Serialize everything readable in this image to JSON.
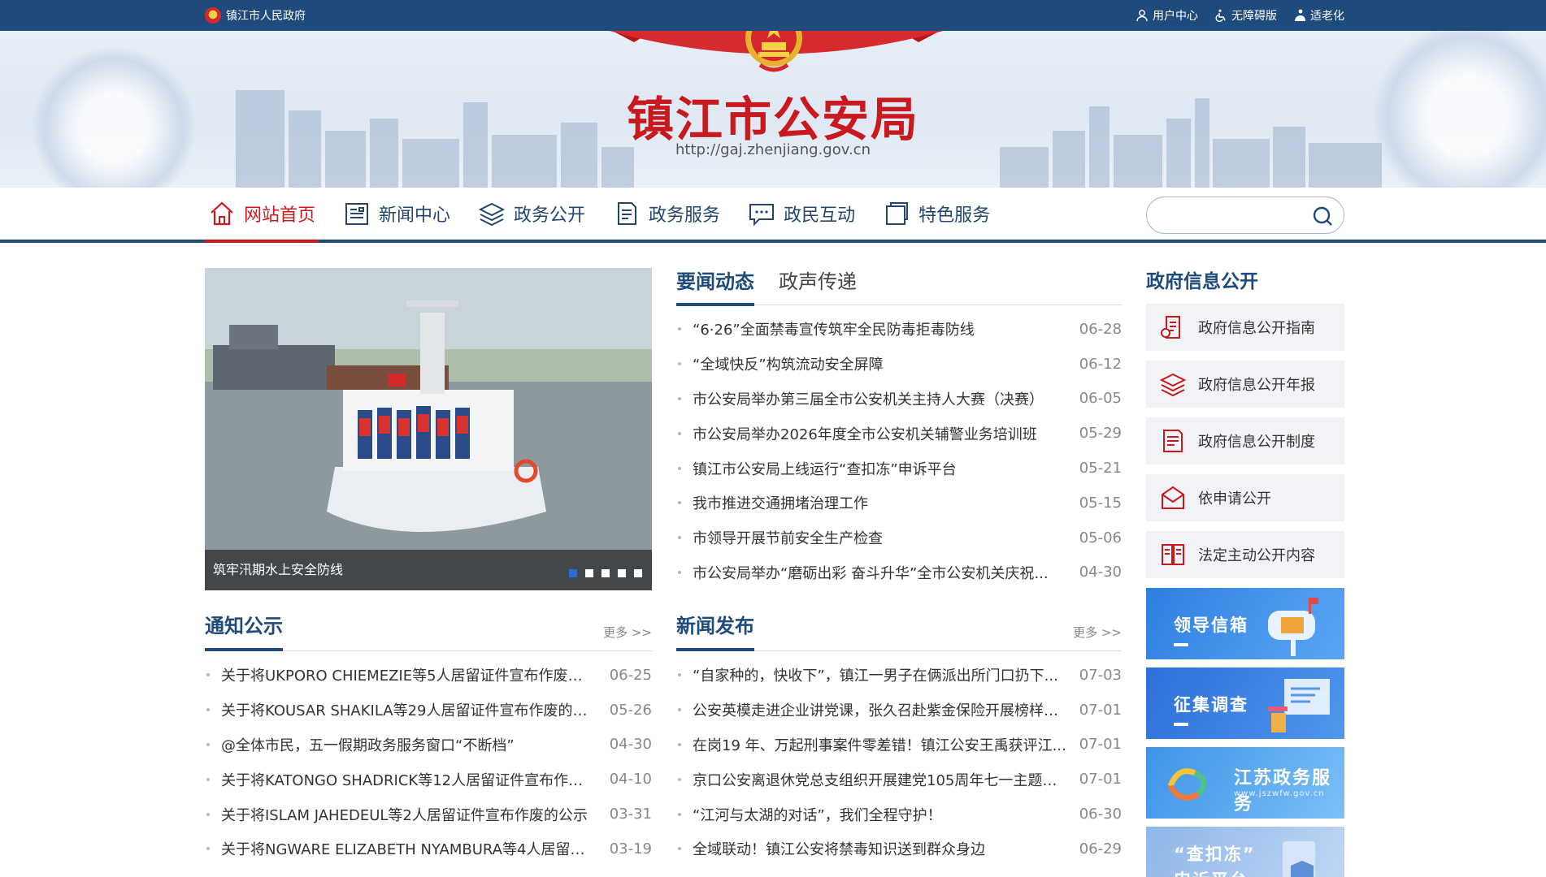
{
  "topbar": {
    "gov_link": "镇江市人民政府",
    "tools": [
      "用户中心",
      "无障碍版",
      "适老化"
    ]
  },
  "header": {
    "title": "镇江市公安局",
    "url": "http://gaj.zhenjiang.gov.cn"
  },
  "nav": {
    "items": [
      {
        "label": "网站首页",
        "icon": "home-icon",
        "active": true
      },
      {
        "label": "新闻中心",
        "icon": "newspaper-icon"
      },
      {
        "label": "政务公开",
        "icon": "layers-icon"
      },
      {
        "label": "政务服务",
        "icon": "document-icon"
      },
      {
        "label": "政民互动",
        "icon": "chat-icon"
      },
      {
        "label": "特色服务",
        "icon": "window-icon"
      }
    ],
    "search_placeholder": ""
  },
  "slider": {
    "caption": "筑牢汛期水上安全防线",
    "dots": 5,
    "active_dot": 1
  },
  "news_tabs": {
    "tabs": [
      "要闻动态",
      "政声传递"
    ],
    "active": 0,
    "items": [
      {
        "title": "“6·26”全面禁毒宣传筑牢全民防毒拒毒防线",
        "date": "06-28"
      },
      {
        "title": "“全域快反”构筑流动安全屏障",
        "date": "06-12"
      },
      {
        "title": "市公安局举办第三届全市公安机关主持人大赛（决赛）",
        "date": "06-05"
      },
      {
        "title": "市公安局举办2026年度全市公安机关辅警业务培训班",
        "date": "05-29"
      },
      {
        "title": "镇江市公安局上线运行“查扣冻”申诉平台",
        "date": "05-21"
      },
      {
        "title": "我市推进交通拥堵治理工作",
        "date": "05-15"
      },
      {
        "title": "市领导开展节前安全生产检查",
        "date": "05-06"
      },
      {
        "title": "市公安局举办“磨砺出彩 奋斗升华”全市公安机关庆祝...",
        "date": "04-30"
      }
    ]
  },
  "notices": {
    "title": "通知公示",
    "more": "更多 >>",
    "items": [
      {
        "title": "关于将UKPORO CHIEMEZIE等5人居留证件宣布作废的...",
        "date": "06-25"
      },
      {
        "title": "关于将KOUSAR SHAKILA等29人居留证件宣布作废的公示",
        "date": "05-26"
      },
      {
        "title": "@全体市民，五一假期政务服务窗口“不断档”",
        "date": "04-30"
      },
      {
        "title": "关于将KATONGO SHADRICK等12人居留证件宣布作废...",
        "date": "04-10"
      },
      {
        "title": "关于将ISLAM JAHEDEUL等2人居留证件宣布作废的公示",
        "date": "03-31"
      },
      {
        "title": "关于将NGWARE ELIZABETH NYAMBURA等4人居留证...",
        "date": "03-19"
      }
    ]
  },
  "press": {
    "title": "新闻发布",
    "more": "更多 >>",
    "items": [
      {
        "title": "“自家种的，快收下”，镇江一男子在俩派出所门口扔下...",
        "date": "07-03"
      },
      {
        "title": "公安英模走进企业讲党课，张久召赴紫金保险开展榜样力...",
        "date": "07-01"
      },
      {
        "title": "在岗19 年、万起刑事案件零差错！镇江公安王禹获评江...",
        "date": "07-01"
      },
      {
        "title": "京口公安离退休党总支组织开展建党105周年七一主题党...",
        "date": "07-01"
      },
      {
        "title": "“江河与太湖的对话”，我们全程守护！",
        "date": "06-30"
      },
      {
        "title": "全域联动！镇江公安将禁毒知识送到群众身边",
        "date": "06-29"
      }
    ]
  },
  "gov_info": {
    "title": "政府信息公开",
    "buttons": [
      {
        "label": "政府信息公开指南",
        "icon": "guide-icon"
      },
      {
        "label": "政府信息公开年报",
        "icon": "layers-icon"
      },
      {
        "label": "政府信息公开制度",
        "icon": "rules-icon"
      },
      {
        "label": "依申请公开",
        "icon": "envelope-icon"
      },
      {
        "label": "法定主动公开内容",
        "icon": "book-icon"
      }
    ]
  },
  "promos": {
    "mailbox": "领导信箱",
    "survey": "征集调查",
    "jiangsu": "江苏政务服务",
    "jiangsu_sub": "www.jszwfw.gov.cn",
    "appeal_line1": "“查扣冻”",
    "appeal_line2": "申诉平台"
  },
  "colors": {
    "brand_blue": "#1f4a7c",
    "accent_red": "#c8191f"
  }
}
